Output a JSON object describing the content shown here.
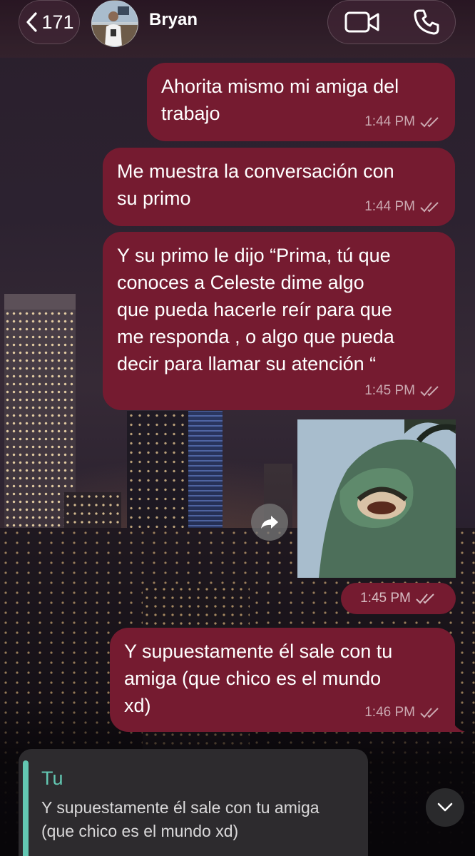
{
  "header": {
    "back_count": "171",
    "contact_name": "Bryan",
    "video_call_icon": "video-camera-icon",
    "voice_call_icon": "phone-icon"
  },
  "colors": {
    "outgoing_bubble": "#751b30",
    "reply_accent": "#63c7b2",
    "reply_bar": "#2d2b2e"
  },
  "messages": [
    {
      "type": "text",
      "text": "Ahorita mismo mi amiga del\ntrabajo",
      "time": "1:44 PM",
      "status": "read-double-check"
    },
    {
      "type": "text",
      "text": "Me muestra la conversación con\nsu primo",
      "time": "1:44 PM",
      "status": "read-double-check"
    },
    {
      "type": "text",
      "text": "Y su primo le dijo “Prima, tú que\nconoces a Celeste dime algo\nque pueda hacerle reír para que\nme responda , o algo que pueda\ndecir para llamar su atención “",
      "time": "1:45 PM",
      "status": "read-double-check"
    },
    {
      "type": "image",
      "time": "1:45 PM",
      "status": "read-double-check"
    },
    {
      "type": "text",
      "text": "Y supuestamente él sale con tu\namiga (que chico es el mundo\nxd)",
      "time": "1:46 PM",
      "status": "read-double-check"
    }
  ],
  "reply": {
    "author": "Tu",
    "text": "Y supuestamente él sale con tu amiga\n(que chico es el mundo xd)"
  }
}
